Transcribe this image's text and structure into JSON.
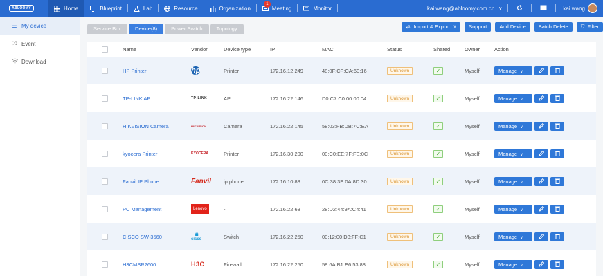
{
  "app": {
    "logo_text": "ABLOOMY"
  },
  "nav": {
    "items": [
      {
        "label": "Home",
        "icon": "home-grid-icon"
      },
      {
        "label": "Blueprint",
        "icon": "monitor-icon"
      },
      {
        "label": "Lab",
        "icon": "flask-icon"
      },
      {
        "label": "Resource",
        "icon": "globe-icon"
      },
      {
        "label": "Organization",
        "icon": "org-chart-icon"
      },
      {
        "label": "Meeting",
        "icon": "meeting-icon",
        "badge": "1"
      },
      {
        "label": "Monitor",
        "icon": "screen-icon"
      }
    ],
    "user_email": "kai.wang@abloomy.com.cn",
    "user_name": "kai.wang"
  },
  "sidebar": {
    "items": [
      {
        "label": "My device",
        "icon": "list-icon",
        "active": true
      },
      {
        "label": "Event",
        "icon": "shuffle-icon"
      },
      {
        "label": "Download",
        "icon": "wifi-icon"
      }
    ]
  },
  "tabs": [
    {
      "label": "Service Box"
    },
    {
      "label": "Device(8)",
      "active": true
    },
    {
      "label": "Power Switch"
    },
    {
      "label": "Topology"
    }
  ],
  "toolbar": {
    "import_export": "Import & Export",
    "support": "Support",
    "add_device": "Add Device",
    "batch_delete": "Batch Delete",
    "filter": "Filter"
  },
  "table": {
    "headers": {
      "name": "Name",
      "vendor": "Vendor",
      "device_type": "Device type",
      "ip": "IP",
      "mac": "MAC",
      "status": "Status",
      "shared": "Shared",
      "owner": "Owner",
      "action": "Action"
    },
    "manage_label": "Manage",
    "rows": [
      {
        "name": "HP Printer",
        "vendor": "hp",
        "vendor_logo": "hp",
        "type": "Printer",
        "ip": "172.16.12.249",
        "mac": "48:0F:CF:CA:60:16",
        "status": "Unknown",
        "owner": "Myself"
      },
      {
        "name": "TP-LINK AP",
        "vendor": "TP-LINK",
        "vendor_logo": "tplink",
        "type": "AP",
        "ip": "172.16.22.146",
        "mac": "D0:C7:C0:00:00:04",
        "status": "Unknown",
        "owner": "Myself"
      },
      {
        "name": "HIKVISION Camera",
        "vendor": "HIKVISION",
        "vendor_logo": "hik",
        "type": "Camera",
        "ip": "172.16.22.145",
        "mac": "58:03:FB:DB:7C:EA",
        "status": "Unknown",
        "owner": "Myself"
      },
      {
        "name": "kyocera Printer",
        "vendor": "KYOCERA",
        "vendor_logo": "kyo",
        "type": "Printer",
        "ip": "172.16.30.200",
        "mac": "00:C0:EE:7F:FE:0C",
        "status": "Unknown",
        "owner": "Myself"
      },
      {
        "name": "Fanvil IP Phone",
        "vendor": "Fanvil",
        "vendor_logo": "fanvil",
        "type": "ip phone",
        "ip": "172.16.10.88",
        "mac": "0C:38:3E:0A:8D:30",
        "status": "Unknown",
        "owner": "Myself"
      },
      {
        "name": "PC Management",
        "vendor": "Lenovo",
        "vendor_logo": "lenovo",
        "type": "-",
        "ip": "172.16.22.68",
        "mac": "28:D2:44:9A:C4:41",
        "status": "Unknown",
        "owner": "Myself"
      },
      {
        "name": "CISCO SW-3560",
        "vendor": "cisco",
        "vendor_logo": "cisco",
        "type": "Switch",
        "ip": "172.16.22.250",
        "mac": "00:12:00:D3:FF:C1",
        "status": "Unknown",
        "owner": "Myself"
      },
      {
        "name": "H3CMSR2600",
        "vendor": "H3C",
        "vendor_logo": "h3c",
        "type": "Firewall",
        "ip": "172.16.22.250",
        "mac": "58:6A:B1:E6:53:88",
        "status": "Unknown",
        "owner": "Myself"
      }
    ]
  },
  "colors": {
    "primary": "#2a6cd1",
    "row_alt": "#eef3fa",
    "status_unknown": "#d9922c",
    "shared_ok": "#58b045"
  }
}
